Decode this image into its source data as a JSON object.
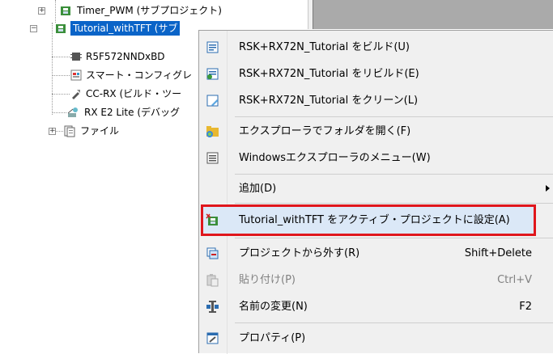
{
  "tree": {
    "items": [
      {
        "label": "Timer_PWM (サブプロジェクト)",
        "icon": "project-icon"
      },
      {
        "label": "Tutorial_withTFT (サブ",
        "icon": "project-icon"
      },
      {
        "label": "R5F572NNDxBD",
        "icon": "chip-icon"
      },
      {
        "label": "スマート・コンフィグレ",
        "icon": "smart-config-icon"
      },
      {
        "label": "CC-RX (ビルド・ツー",
        "icon": "build-tool-icon"
      },
      {
        "label": "RX E2 Lite (デバッグ",
        "icon": "debugger-icon"
      },
      {
        "label": "ファイル",
        "icon": "folder-icon"
      }
    ]
  },
  "menu": {
    "items": [
      {
        "label": "RSK+RX72N_Tutorial をビルド(U)",
        "shortcut": "",
        "icon": "build-icon"
      },
      {
        "label": "RSK+RX72N_Tutorial をリビルド(E)",
        "shortcut": "",
        "icon": "rebuild-icon"
      },
      {
        "label": "RSK+RX72N_Tutorial をクリーン(L)",
        "shortcut": "",
        "icon": "clean-icon"
      },
      {
        "label": "エクスプローラでフォルダを開く(F)",
        "shortcut": "",
        "icon": "open-folder-icon"
      },
      {
        "label": "Windowsエクスプローラのメニュー(W)",
        "shortcut": "",
        "icon": "explorer-menu-icon"
      },
      {
        "label": "追加(D)",
        "shortcut": "",
        "icon": ""
      },
      {
        "label": "Tutorial_withTFT をアクティブ・プロジェクトに設定(A)",
        "shortcut": "",
        "icon": "active-project-icon"
      },
      {
        "label": "プロジェクトから外す(R)",
        "shortcut": "Shift+Delete",
        "icon": "remove-project-icon"
      },
      {
        "label": "貼り付け(P)",
        "shortcut": "Ctrl+V",
        "icon": "paste-icon"
      },
      {
        "label": "名前の変更(N)",
        "shortcut": "F2",
        "icon": "rename-icon"
      },
      {
        "label": "プロパティ(P)",
        "shortcut": "",
        "icon": "properties-icon"
      }
    ]
  },
  "colors": {
    "selection": "#0a64c8",
    "highlight_border": "#e0161c",
    "menu_background": "#f0f0f0"
  }
}
